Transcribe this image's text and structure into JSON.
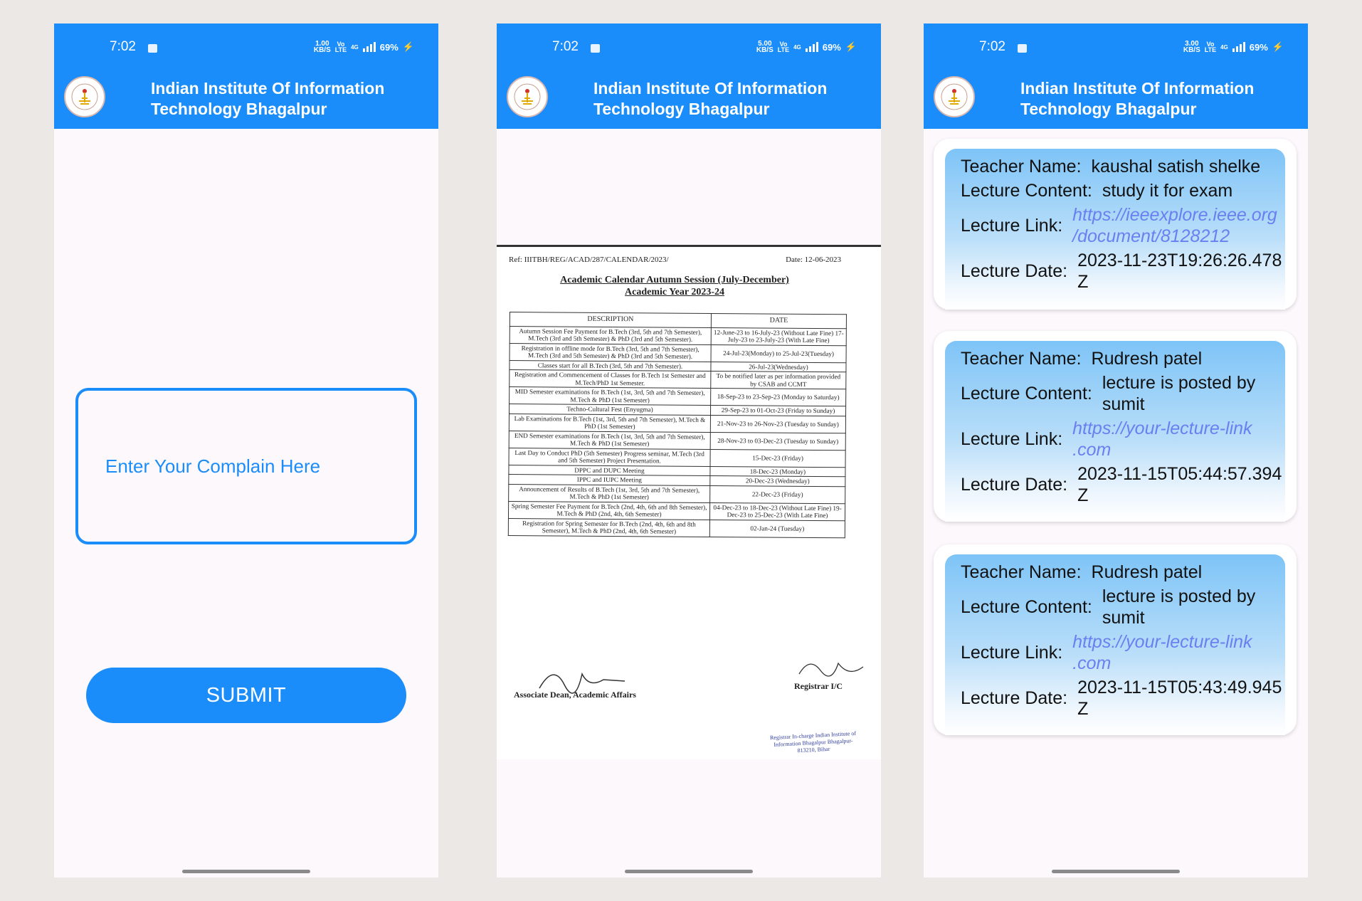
{
  "status_bar": {
    "time": "7:02",
    "screen1_speed": [
      "1.00",
      "KB/S"
    ],
    "screen2_speed": [
      "5.00",
      "KB/S"
    ],
    "screen3_speed": [
      "3.00",
      "KB/S"
    ],
    "volte": [
      "Vo",
      "LTE"
    ],
    "network": "4G",
    "battery": "69%"
  },
  "app": {
    "title": "Indian Institute Of Information Technology Bhagalpur"
  },
  "complaint": {
    "placeholder": "Enter Your Complain Here",
    "submit_label": "SUBMIT"
  },
  "calendar": {
    "ref": "Ref: IIITBH/REG/ACAD/287/CALENDAR/2023/",
    "date": "Date: 12-06-2023",
    "heading1": "Academic Calendar Autumn Session (July-December)",
    "heading2": "Academic Year 2023-24",
    "col_description": "DESCRIPTION",
    "col_date": "DATE",
    "rows": [
      {
        "desc": "Autumn Session Fee Payment for B.Tech (3rd, 5th and 7th Semester), M.Tech (3rd and 5th Semester) & PhD (3rd and 5th Semester).",
        "date": "12-June-23 to 16-July-23 (Without Late Fine) 17-July-23 to 23-July-23 (With Late Fine)"
      },
      {
        "desc": "Registration in offline mode for B.Tech (3rd, 5th and 7th Semester), M.Tech (3rd and 5th Semester) & PhD (3rd and 5th Semester).",
        "date": "24-Jul-23(Monday) to 25-Jul-23(Tuesday)"
      },
      {
        "desc": "Classes start for all B.Tech (3rd, 5th and 7th Semester).",
        "date": "26-Jul-23(Wednesday)"
      },
      {
        "desc": "Registration and Commencement of Classes for B.Tech 1st Semester and M.Tech/PhD 1st Semester.",
        "date": "To be notified later as per information provided by CSAB and CCMT"
      },
      {
        "desc": "MID Semester examinations for B.Tech (1st, 3rd, 5th and 7th Semester), M.Tech & PhD (1st Semester)",
        "date": "18-Sep-23 to 23-Sep-23 (Monday to Saturday)"
      },
      {
        "desc": "Techno-Cultural Fest (Enyugma)",
        "date": "29-Sep-23 to 01-Oct-23 (Friday to Sunday)"
      },
      {
        "desc": "Lab Examinations for B.Tech (1st, 3rd, 5th and 7th Semester), M.Tech & PhD (1st Semester)",
        "date": "21-Nov-23 to 26-Nov-23 (Tuesday to Sunday)"
      },
      {
        "desc": "END Semester examinations for B.Tech (1st, 3rd, 5th and 7th Semester), M.Tech & PhD (1st Semester)",
        "date": "28-Nov-23 to 03-Dec-23 (Tuesday to Sunday)"
      },
      {
        "desc": "Last Day to Conduct PhD (5th Semester) Progress seminar, M.Tech (3rd and 5th Semester) Project Presentation.",
        "date": "15-Dec-23 (Friday)"
      },
      {
        "desc": "DPPC and DUPC Meeting",
        "date": "18-Dec-23 (Monday)"
      },
      {
        "desc": "IPPC and IUPC Meeting",
        "date": "20-Dec-23 (Wednesday)"
      },
      {
        "desc": "Announcement of Results of B.Tech (1st, 3rd, 5th and 7th Semester), M.Tech & PhD (1st Semester)",
        "date": "22-Dec-23 (Friday)"
      },
      {
        "desc": "Spring Semester Fee Payment for B.Tech (2nd, 4th, 6th and 8th Semester), M.Tech & PhD (2nd, 4th, 6th Semester)",
        "date": "04-Dec-23 to 18-Dec-23 (Without Late Fine) 19-Dec-23 to 25-Dec-23 (With Late Fine)"
      },
      {
        "desc": "Registration for Spring Semester for B.Tech (2nd, 4th, 6th and 8th Semester), M.Tech & PhD (2nd, 4th, 6th Semester)",
        "date": "02-Jan-24 (Tuesday)"
      }
    ],
    "sign_left": "Associate Dean, Academic Affairs",
    "sign_right": "Registrar I/C",
    "stamp": "Registrar In-charge Indian Institute of Information Bhagalpur Bhagalpur-813210, Bihar"
  },
  "lectures": {
    "labels": {
      "teacher": "Teacher Name:",
      "content": "Lecture Content:",
      "link": "Lecture Link:",
      "date": "Lecture Date:"
    },
    "items": [
      {
        "teacher": "kaushal satish shelke",
        "content": "study it for exam",
        "link": "https://ieeexplore.ieee.org/document/8128212",
        "link_l1": "https://ieeexplore.ieee.org",
        "link_l2": "/document/8128212",
        "date_l1": "2023-11-23T19:26:26.478",
        "date_l2": "Z"
      },
      {
        "teacher": "Rudresh patel",
        "content_l1": "lecture is posted by",
        "content_l2": "sumit",
        "link_l1": "https://your-lecture-link",
        "link_l2": ".com",
        "date_l1": "2023-11-15T05:44:57.394",
        "date_l2": "Z"
      },
      {
        "teacher": "Rudresh patel",
        "content_l1": "lecture is posted by",
        "content_l2": "sumit",
        "link_l1": "https://your-lecture-link",
        "link_l2": ".com",
        "date_l1": "2023-11-15T05:43:49.945",
        "date_l2": "Z"
      }
    ]
  },
  "colors": {
    "primary": "#1a8dfa",
    "link": "#6a7ff0",
    "background": "#ebe8e6"
  }
}
